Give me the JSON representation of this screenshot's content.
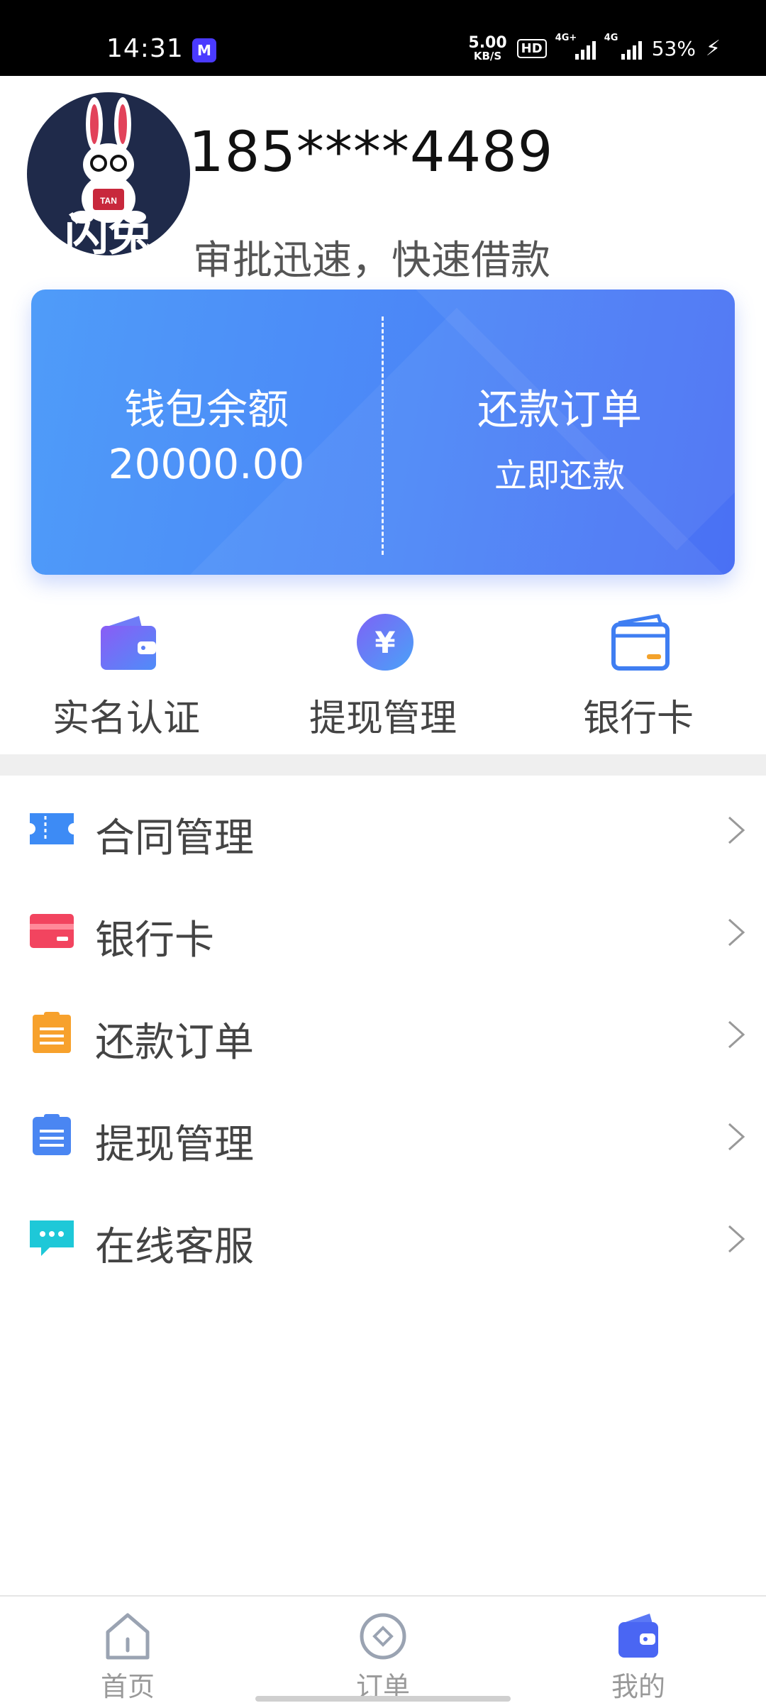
{
  "status_bar": {
    "time": "14:31",
    "app_badge": "M",
    "net_speed_value": "5.00",
    "net_speed_unit": "KB/S",
    "hd_badge": "HD",
    "signal1_label": "4G+",
    "signal2_label": "4G",
    "battery": "53%",
    "charging_icon": "bolt-icon"
  },
  "profile": {
    "avatar_icon": "rabbit-logo",
    "phone": "185****4489",
    "slogan": "审批迅速，快速借款"
  },
  "balance_card": {
    "wallet_title": "钱包余额",
    "wallet_amount": "20000.00",
    "repay_title": "还款订单",
    "repay_link": "立即还款",
    "gradient_start": "#4f9cf9",
    "gradient_end": "#4a70f4"
  },
  "quick_actions": [
    {
      "label": "实名认证",
      "icon": "wallet-icon"
    },
    {
      "label": "提现管理",
      "icon": "yuan-icon"
    },
    {
      "label": "银行卡",
      "icon": "card-icon"
    }
  ],
  "menu": [
    {
      "label": "合同管理",
      "icon": "ticket-icon",
      "color": "#3d8bf5"
    },
    {
      "label": "银行卡",
      "icon": "credit-card-icon",
      "color": "#f2445f"
    },
    {
      "label": "还款订单",
      "icon": "clipboard-orange-icon",
      "color": "#f7a12c"
    },
    {
      "label": "提现管理",
      "icon": "clipboard-blue-icon",
      "color": "#4a86f2"
    },
    {
      "label": "在线客服",
      "icon": "chat-icon",
      "color": "#1ec8d8"
    }
  ],
  "bottom_nav": [
    {
      "label": "首页",
      "icon": "home-icon",
      "active": false
    },
    {
      "label": "订单",
      "icon": "order-icon",
      "active": false
    },
    {
      "label": "我的",
      "icon": "wallet-nav-icon",
      "active": true
    }
  ],
  "colors": {
    "accent": "#4a78f4",
    "band": "#efefef"
  }
}
